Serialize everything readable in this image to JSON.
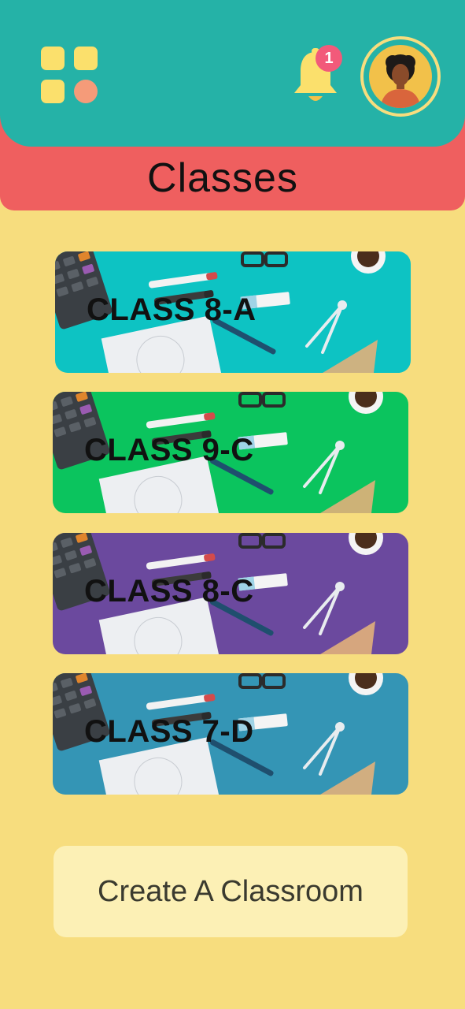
{
  "header": {
    "title": "Classes",
    "notification_count": "1",
    "menu_icon": "grid-icon",
    "notification_icon": "bell-icon",
    "avatar_icon": "avatar"
  },
  "colors": {
    "background": "#F7DD7E",
    "header_teal": "#25B2A7",
    "header_red": "#EF5F5F",
    "badge": "#F25A7A",
    "button_bg": "#FCF0B5"
  },
  "classes": [
    {
      "label": "CLASS 8-A",
      "color": "#0DC3C3"
    },
    {
      "label": "CLASS 9-C",
      "color": "#0BC45E"
    },
    {
      "label": "CLASS 8-C",
      "color": "#6B499E"
    },
    {
      "label": "CLASS 7-D",
      "color": "#3495B5"
    }
  ],
  "actions": {
    "create_label": "Create A Classroom"
  }
}
